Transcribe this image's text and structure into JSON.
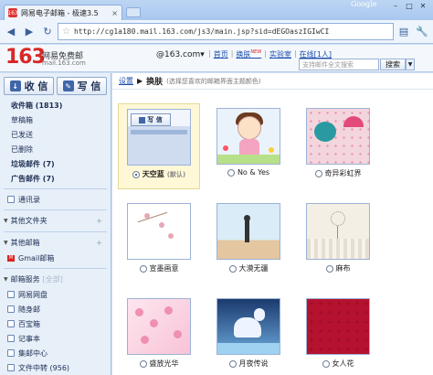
{
  "browser": {
    "tab_title": "网易电子邮箱 - 极速3.5",
    "tab_close": "×",
    "favicon_text": "163",
    "brand": "Google",
    "address": "http://cg1a180.mail.163.com/js3/main.jsp?sid=dEGOaszIGIwCI",
    "back_icon": "◀",
    "forward_icon": "▶",
    "reload_icon": "↻",
    "star_icon": "☆",
    "page_menu_icon": "▤",
    "tools_icon": "🔧",
    "win_min": "–",
    "win_max": "□",
    "win_close": "✕"
  },
  "header": {
    "logo": "163",
    "logo_text": "网易免费邮",
    "logo_sub": "mail.163.com",
    "account": "@163.com▾",
    "links": [
      "首页",
      "换肤",
      "实验室",
      "在线[1人]"
    ],
    "new_badge": "NEW",
    "search_placeholder": "支持邮件全文搜索",
    "search_button": "搜索",
    "search_drop": "▼"
  },
  "sidebar": {
    "receive": "收 信",
    "compose": "写 信",
    "receive_icon": "↓",
    "compose_icon": "✎",
    "folders": [
      {
        "label": "收件箱 (1813)",
        "bold": true
      },
      {
        "label": "草稿箱",
        "bold": false
      },
      {
        "label": "已发送",
        "bold": false
      },
      {
        "label": "已删除",
        "bold": false
      },
      {
        "label": "垃圾邮件 (7)",
        "bold": true
      },
      {
        "label": "广告邮件 (7)",
        "bold": true
      }
    ],
    "contacts": "通讯录",
    "sec_other_folders": "其他文件夹",
    "sec_other_mail": "其他邮箱",
    "gmail": "Gmail邮箱",
    "sec_services": "邮箱服务",
    "sec_services_all": "[全部]",
    "services": [
      "网易网盘",
      "随身邮",
      "百宝箱",
      "记事本",
      "集邮中心",
      "文件中转 (956)"
    ],
    "collapse_icon": "▼",
    "plus_icon": "+"
  },
  "main": {
    "crumb_link": "设置",
    "crumb_sep": "▶",
    "crumb_current": "换肤",
    "crumb_hint": "(选择您喜欢的邮箱界面主题颜色)",
    "skins": [
      {
        "name": "天空蓝",
        "suffix": "(默认)",
        "selected": true,
        "art": "sky"
      },
      {
        "name": "No & Yes",
        "suffix": "",
        "selected": false,
        "art": "noyes"
      },
      {
        "name": "奇异彩虹界",
        "suffix": "",
        "selected": false,
        "art": "rainbow"
      },
      {
        "name": "宣墨画意",
        "suffix": "",
        "selected": false,
        "art": "plain"
      },
      {
        "name": "大漠无疆",
        "suffix": "",
        "selected": false,
        "art": "desert"
      },
      {
        "name": "麻布",
        "suffix": "",
        "selected": false,
        "art": "linen"
      },
      {
        "name": "盛放光华",
        "suffix": "",
        "selected": false,
        "art": "blossom"
      },
      {
        "name": "月夜传说",
        "suffix": "",
        "selected": false,
        "art": "moon"
      },
      {
        "name": "女人花",
        "suffix": "",
        "selected": false,
        "art": "lady"
      }
    ],
    "preview_label": "写 信"
  }
}
